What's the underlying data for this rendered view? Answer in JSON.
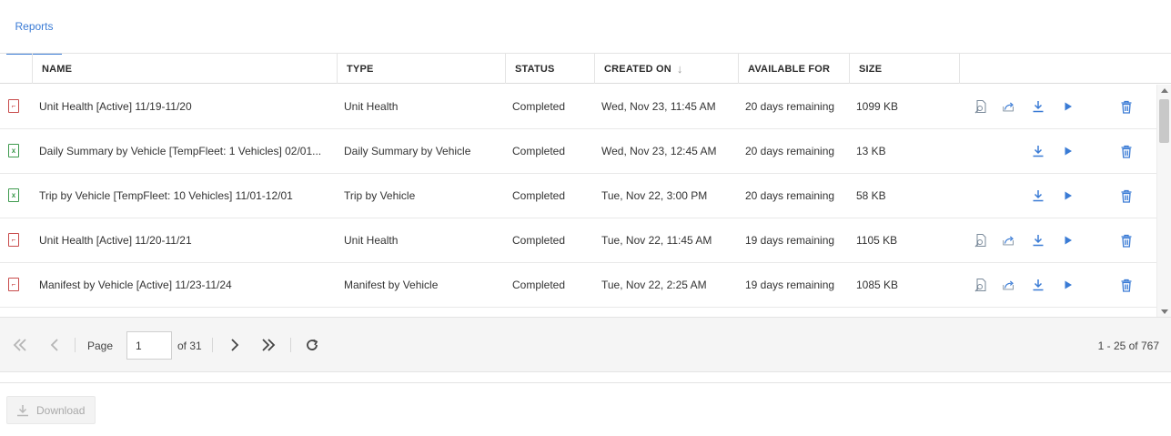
{
  "tabs": [
    {
      "label": "Reports"
    }
  ],
  "columns": {
    "name": "NAME",
    "type": "TYPE",
    "status": "STATUS",
    "created_on": "CREATED ON",
    "available_for": "AVAILABLE FOR",
    "size": "SIZE"
  },
  "sort": {
    "column": "created_on",
    "direction": "descending",
    "indicator": "↓"
  },
  "rows": [
    {
      "file_type": "pdf",
      "name": "Unit Health [Active] 11/19-11/20",
      "type": "Unit Health",
      "status": "Completed",
      "created_on": "Wed, Nov 23, 11:45 AM",
      "available_for": "20 days remaining",
      "size": "1099 KB",
      "actions": [
        "preview",
        "share",
        "download",
        "run",
        "delete"
      ]
    },
    {
      "file_type": "xls",
      "name": "Daily Summary by Vehicle [TempFleet: 1 Vehicles] 02/01...",
      "type": "Daily Summary by Vehicle",
      "status": "Completed",
      "created_on": "Wed, Nov 23, 12:45 AM",
      "available_for": "20 days remaining",
      "size": "13 KB",
      "actions": [
        "download",
        "run",
        "delete"
      ]
    },
    {
      "file_type": "xls",
      "name": "Trip by Vehicle [TempFleet: 10 Vehicles] 11/01-12/01",
      "type": "Trip by Vehicle",
      "status": "Completed",
      "created_on": "Tue, Nov 22, 3:00 PM",
      "available_for": "20 days remaining",
      "size": "58 KB",
      "actions": [
        "download",
        "run",
        "delete"
      ]
    },
    {
      "file_type": "pdf",
      "name": "Unit Health [Active] 11/20-11/21",
      "type": "Unit Health",
      "status": "Completed",
      "created_on": "Tue, Nov 22, 11:45 AM",
      "available_for": "19 days remaining",
      "size": "1105 KB",
      "actions": [
        "preview",
        "share",
        "download",
        "run",
        "delete"
      ]
    },
    {
      "file_type": "pdf",
      "name": "Manifest by Vehicle [Active] 11/23-11/24",
      "type": "Manifest by Vehicle",
      "status": "Completed",
      "created_on": "Tue, Nov 22, 2:25 AM",
      "available_for": "19 days remaining",
      "size": "1085 KB",
      "actions": [
        "preview",
        "share",
        "download",
        "run",
        "delete"
      ]
    }
  ],
  "pager": {
    "page_label": "Page",
    "page_value": "1",
    "of_label": "of 31",
    "records_label": "1 - 25 of 767"
  },
  "footer": {
    "download_label": "Download"
  },
  "colors": {
    "accent": "#3a7bd5",
    "pdf": "#c84b4b",
    "xls": "#3e9a4e",
    "icon_blue": "#3a7bd5"
  }
}
